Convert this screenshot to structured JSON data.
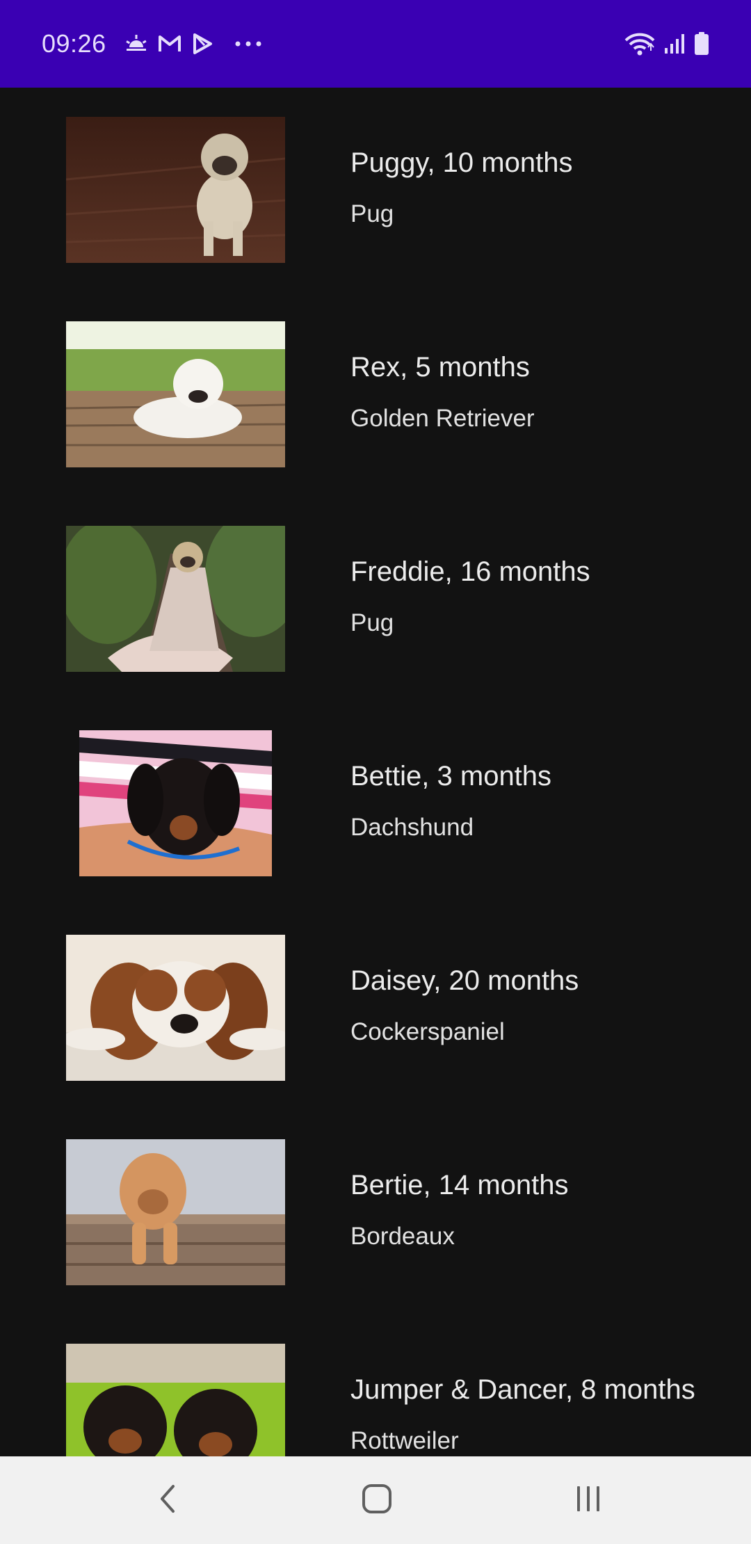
{
  "status_bar": {
    "time": "09:26",
    "background": "#3a00b3",
    "left_icons": [
      "weather-sunrise-icon",
      "gmail-icon",
      "play-store-icon",
      "more-dots-icon"
    ],
    "right_icons": [
      "wifi-icon",
      "signal-icon",
      "battery-icon"
    ]
  },
  "dogs": [
    {
      "title": "Puggy, 10 months",
      "breed": "Pug",
      "photo": "pug puppy on wooden floor"
    },
    {
      "title": "Rex, 5 months",
      "breed": "Golden Retriever",
      "photo": "white puppy lying on wooden deck"
    },
    {
      "title": "Freddie, 16 months",
      "breed": "Pug",
      "photo": "pug wrapped in blanket on forest path"
    },
    {
      "title": "Bettie, 3 months",
      "breed": "Dachshund",
      "photo": "black dachshund puppy on arm"
    },
    {
      "title": "Daisey, 20 months",
      "breed": "Cockerspaniel",
      "photo": "spaniel lying on rug"
    },
    {
      "title": "Bertie, 14 months",
      "breed": "Bordeaux",
      "photo": "puppy in wooden crate"
    },
    {
      "title": "Jumper & Dancer, 8 months",
      "breed": "Rottweiler",
      "photo": "two rottweiler puppies"
    }
  ],
  "nav_bar": {
    "buttons": [
      "back-icon",
      "home-icon",
      "recents-icon"
    ]
  }
}
